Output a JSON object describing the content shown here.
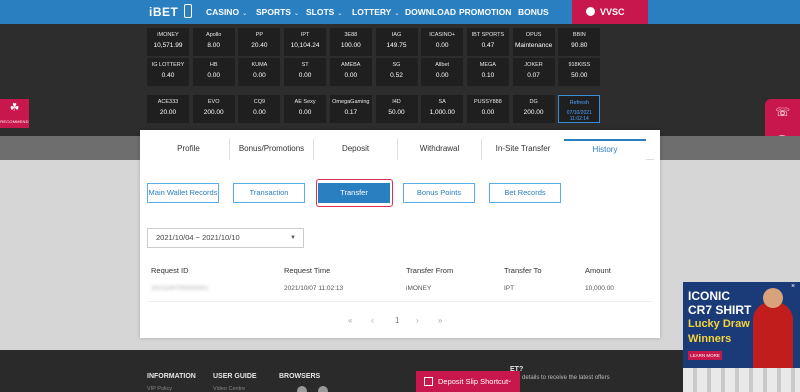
{
  "nav": {
    "logo": "iBET",
    "items": [
      {
        "label": "CASINO",
        "caret": true
      },
      {
        "label": "SPORTS",
        "caret": true
      },
      {
        "label": "SLOTS",
        "caret": true
      },
      {
        "label": "LOTTERY",
        "caret": true
      },
      {
        "label": "DOWNLOAD",
        "caret": false
      },
      {
        "label": "PROMOTION",
        "caret": false
      },
      {
        "label": "BONUS",
        "caret": false
      }
    ],
    "user": "VVSC"
  },
  "wallets": [
    {
      "name": "iMONEY",
      "value": "10,571.99"
    },
    {
      "name": "Apollo",
      "value": "8.00"
    },
    {
      "name": "PP",
      "value": "20.40"
    },
    {
      "name": "IPT",
      "value": "10,104.24"
    },
    {
      "name": "3E88",
      "value": "100.00"
    },
    {
      "name": "IAG",
      "value": "149.75"
    },
    {
      "name": "ICASINO+",
      "value": "0.00"
    },
    {
      "name": "IBT SPORTS",
      "value": "0.47"
    },
    {
      "name": "OPUS",
      "value": "Maintenance"
    },
    {
      "name": "BBIN",
      "value": "90.80"
    },
    {
      "name": "IG LOTTERY",
      "value": "0.40"
    },
    {
      "name": "HB",
      "value": "0.00"
    },
    {
      "name": "KUMA",
      "value": "0.00"
    },
    {
      "name": "ST",
      "value": "0.00"
    },
    {
      "name": "AMEBA",
      "value": "0.00"
    },
    {
      "name": "SG",
      "value": "0.52"
    },
    {
      "name": "Allbet",
      "value": "0.00"
    },
    {
      "name": "MEGA",
      "value": "0.10"
    },
    {
      "name": "JOKER",
      "value": "0.07"
    },
    {
      "name": "918KISS",
      "value": "50.00"
    },
    {
      "name": "ACE333",
      "value": "20.00"
    },
    {
      "name": "EVO",
      "value": "200.00"
    },
    {
      "name": "CQ9",
      "value": "0.00"
    },
    {
      "name": "AE Sexy",
      "value": "0.00"
    },
    {
      "name": "OmegaGaming",
      "value": "0.17"
    },
    {
      "name": "I4D",
      "value": "50.00"
    },
    {
      "name": "SA",
      "value": "1,000.00"
    },
    {
      "name": "PUSSY888",
      "value": "0.00"
    },
    {
      "name": "DG",
      "value": "200.00"
    }
  ],
  "refresh": {
    "label": "Refresh",
    "date": "07/10/2021",
    "time": "11:02:14"
  },
  "recommend_label": "RECOMMEND",
  "tabs": [
    "Profile",
    "Bonus/Promotions",
    "Deposit",
    "Withdrawal",
    "In-Site Transfer",
    "History"
  ],
  "history_buttons": [
    "Main Wallet Records",
    "Transaction",
    "Transfer",
    "Bonus Points",
    "Bet Records"
  ],
  "date_range": "2021/10/04 ~ 2021/10/10",
  "table": {
    "headers": [
      "Request ID",
      "Request Time",
      "Transfer From",
      "Transfer To",
      "Amount"
    ],
    "rows": [
      {
        "id": "2021100700000001",
        "time": "2021/10/07 11:02:13",
        "from": "iMONEY",
        "to": "IPT",
        "amount": "10,000.00"
      }
    ]
  },
  "pager": {
    "first": "«",
    "prev": "‹",
    "page": "1",
    "next": "›",
    "last": "»"
  },
  "footer": {
    "information": "INFORMATION",
    "user_guide": "USER GUIDE",
    "browsers": "BROWSERS",
    "vip_policy": "VIP Policy",
    "video_center": "Video Centre",
    "deposit_slip": "Deposit Slip Shortcut",
    "stay_head": "ET?",
    "stay_text": "details to receive the latest offers"
  },
  "promo": {
    "l1": "ICONIC",
    "l2": "CR7 SHIRT",
    "l3": "Lucky Draw",
    "l4": "Winners",
    "learn": "LEARN MORE"
  }
}
